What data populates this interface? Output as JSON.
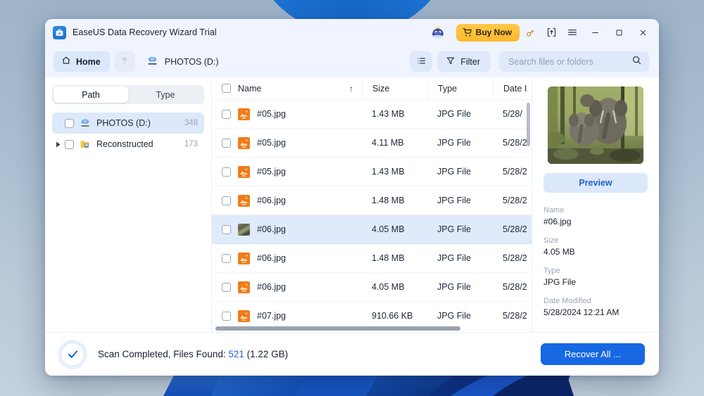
{
  "window": {
    "title": "EaseUS Data Recovery Wizard Trial",
    "logo_icon": "toolbox-star-icon",
    "mascot_icon": "mascot-avatar-icon",
    "buy_now_label": "Buy Now",
    "buy_now_icon": "shopping-cart-icon",
    "buy_now_color": "#fdb92c",
    "controls": {
      "key_icon": "license-key-icon",
      "upgrade_icon": "upgrade-box-icon",
      "menu_icon": "hamburger-menu-icon",
      "minimize_icon": "minimize-icon",
      "maximize_icon": "maximize-icon",
      "close_icon": "close-icon"
    }
  },
  "navbar": {
    "home_label": "Home",
    "home_icon": "home-icon",
    "up_icon": "arrow-up-icon",
    "breadcrumb": "PHOTOS (D:)",
    "breadcrumb_icon": "hard-drive-icon",
    "list_view_icon": "list-view-icon",
    "filter_label": "Filter",
    "filter_icon": "funnel-icon",
    "search_placeholder": "Search files or folders",
    "search_value": "",
    "search_icon": "search-icon"
  },
  "sidebar": {
    "tabs": [
      {
        "label": "Path",
        "active": true
      },
      {
        "label": "Type",
        "active": false
      }
    ],
    "tree": [
      {
        "label": "PHOTOS (D:)",
        "count": "348",
        "icon": "hard-drive-icon",
        "selected": true,
        "expandable": false,
        "checked": false
      },
      {
        "label": "Reconstructed",
        "count": "173",
        "icon": "folder-lock-icon",
        "selected": false,
        "expandable": true,
        "checked": false
      }
    ]
  },
  "table": {
    "columns": [
      "Name",
      "Size",
      "Type",
      "Date I"
    ],
    "sort_arrow": "↑",
    "rows": [
      {
        "name": "#05.jpg",
        "size": "1.43 MB",
        "type": "JPG File",
        "date": "5/28/",
        "icon": "jpg-file-icon",
        "selected": false
      },
      {
        "name": "#05.jpg",
        "size": "4.11 MB",
        "type": "JPG File",
        "date": "5/28/2",
        "icon": "jpg-file-icon",
        "selected": false
      },
      {
        "name": "#05.jpg",
        "size": "1.43 MB",
        "type": "JPG File",
        "date": "5/28/2",
        "icon": "jpg-file-icon",
        "selected": false
      },
      {
        "name": "#06.jpg",
        "size": "1.48 MB",
        "type": "JPG File",
        "date": "5/28/2",
        "icon": "jpg-file-icon",
        "selected": false
      },
      {
        "name": "#06.jpg",
        "size": "4.05 MB",
        "type": "JPG File",
        "date": "5/28/2",
        "icon": "photo-thumbnail-icon",
        "selected": true
      },
      {
        "name": "#06.jpg",
        "size": "1.48 MB",
        "type": "JPG File",
        "date": "5/28/2",
        "icon": "jpg-file-icon",
        "selected": false
      },
      {
        "name": "#06.jpg",
        "size": "4.05 MB",
        "type": "JPG File",
        "date": "5/28/2",
        "icon": "jpg-file-icon",
        "selected": false
      },
      {
        "name": "#07.jpg",
        "size": "910.66 KB",
        "type": "JPG File",
        "date": "5/28/2",
        "icon": "jpg-file-icon",
        "selected": false
      }
    ]
  },
  "details": {
    "preview_label": "Preview",
    "thumbnail_icon": "elephants-photo",
    "fields": [
      {
        "key": "Name",
        "value": "#06.jpg"
      },
      {
        "key": "Size",
        "value": "4.05 MB"
      },
      {
        "key": "Type",
        "value": "JPG File"
      },
      {
        "key": "Date Modified",
        "value": "5/28/2024 12:21 AM"
      }
    ]
  },
  "status": {
    "icon": "check-circle-icon",
    "prefix": "Scan Completed, Files Found: ",
    "count": "521",
    "suffix": " (1.22 GB)",
    "recover_label": "Recover All ...",
    "accent_color": "#1668e3"
  }
}
